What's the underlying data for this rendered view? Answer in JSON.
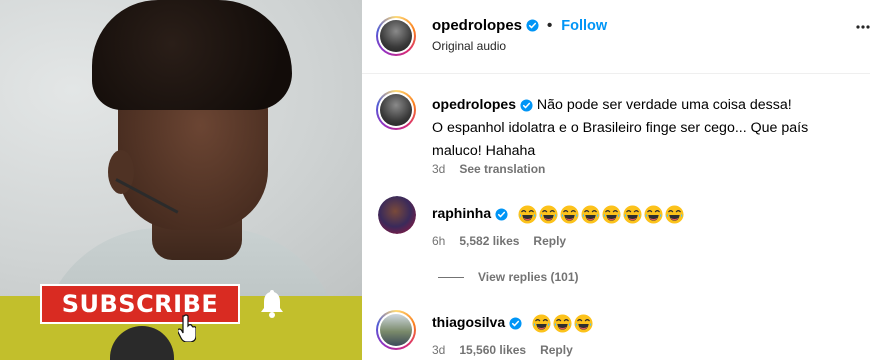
{
  "colors": {
    "accent": "#0095f6",
    "muted": "#737373",
    "subscribe_red": "#d92b22",
    "olive": "#c2bf2c"
  },
  "media": {
    "subscribe_label": "SUBSCRIBE",
    "bell_icon": "bell-icon",
    "cursor_icon": "hand-cursor-icon"
  },
  "header": {
    "username": "opedrolopes",
    "separator": "•",
    "follow_label": "Follow",
    "audio_label": "Original audio",
    "more_icon": "more-options-icon"
  },
  "comments": [
    {
      "username": "opedrolopes",
      "text_line1": "Não pode ser verdade uma coisa dessa!",
      "text_line2": "O espanhol idolatra e o Brasileiro finge ser cego... Que país",
      "text_line3": "maluco! Hahaha",
      "time": "3d",
      "action": "See translation"
    },
    {
      "username": "raphinha",
      "emoji_count": 8,
      "emoji": "rolling-on-floor-laughing",
      "time": "6h",
      "likes": "5,582 likes",
      "reply": "Reply",
      "view_replies": "View replies (101)"
    },
    {
      "username": "thiagosilva",
      "emoji_count": 3,
      "emoji": "rolling-on-floor-laughing",
      "time": "3d",
      "likes": "15,560 likes",
      "reply": "Reply"
    }
  ]
}
